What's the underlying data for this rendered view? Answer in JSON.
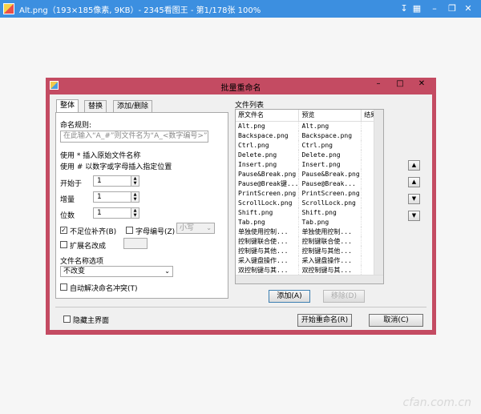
{
  "window": {
    "title": "Alt.png（193×185像素, 9KB）- 2345看图王 - 第1/178张 100%",
    "icons": [
      "pin-icon",
      "minimize-icon",
      "fullscreen-icon",
      "restore-icon",
      "close-icon"
    ]
  },
  "dialog": {
    "title": "批量重命名",
    "tabs": [
      "整体",
      "替换",
      "添加/删除"
    ],
    "rule_label": "命名规则:",
    "rule_placeholder": "在此输入“A_#”则文件名为“A_<数字编号>”",
    "hint1": "使用 * 插入原始文件名称",
    "hint2": "使用 # 以数字或字母插入指定位置",
    "start_label": "开始于",
    "start_value": "1",
    "step_label": "增量",
    "step_value": "1",
    "digits_label": "位数",
    "digits_value": "1",
    "pad_label": "不足位补齐(B)",
    "pad_checked": true,
    "letter_label": "字母编号(Z)",
    "letter_checked": false,
    "case_value": "小写",
    "ext_label": "扩展名改成",
    "ext_checked": false,
    "name_option_label": "文件名称选项",
    "name_option_value": "不改变",
    "auto_resolve_label": "自动解决命名冲突(T)",
    "auto_resolve_checked": false,
    "file_list_label": "文件列表",
    "columns": [
      "原文件名",
      "预览",
      "结果"
    ],
    "rows": [
      [
        "Alt.png",
        "Alt.png",
        ""
      ],
      [
        "Backspace.png",
        "Backspace.png",
        ""
      ],
      [
        "Ctrl.png",
        "Ctrl.png",
        ""
      ],
      [
        "Delete.png",
        "Delete.png",
        ""
      ],
      [
        "Insert.png",
        "Insert.png",
        ""
      ],
      [
        "Pause&Break.png",
        "Pause&Break.png",
        ""
      ],
      [
        "Pause@Break键...",
        "Pause@Break...",
        ""
      ],
      [
        "PrintScreen.png",
        "PrintScreen.png",
        ""
      ],
      [
        "ScrollLock.png",
        "ScrollLock.png",
        ""
      ],
      [
        "Shift.png",
        "Shift.png",
        ""
      ],
      [
        "Tab.png",
        "Tab.png",
        ""
      ],
      [
        "单独使用控制...",
        "单独使用控制...",
        ""
      ],
      [
        "控制键联合使...",
        "控制键联合使...",
        ""
      ],
      [
        "控制键与其他...",
        "控制键与其他...",
        ""
      ],
      [
        "采入键盘操作...",
        "采入键盘操作...",
        ""
      ],
      [
        "双控制键与其...",
        "双控制键与其...",
        ""
      ]
    ],
    "add_button": "添加(A)",
    "remove_button": "移除(D)",
    "hide_main_label": "隐藏主界面",
    "hide_main_checked": false,
    "start_button": "开始重命名(R)",
    "cancel_button": "取消(C)"
  },
  "watermark": "cfan.com.cn",
  "colors": {
    "titlebar": "#3c8fe0",
    "dialog_frame": "#c44b62"
  }
}
